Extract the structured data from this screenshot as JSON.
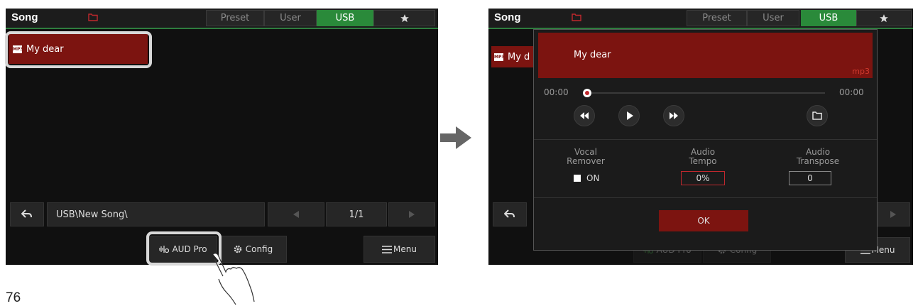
{
  "screen_left": {
    "header": {
      "title": "Song",
      "folder_icon": "folder-icon",
      "tabs": [
        {
          "label": "Preset"
        },
        {
          "label": "User"
        },
        {
          "label": "USB"
        },
        {
          "icon": "star-icon"
        }
      ]
    },
    "song_list": [
      {
        "label": "My dear",
        "icon": "mp3-icon"
      }
    ],
    "path": "USB\\New Song\\",
    "page": "1/1",
    "buttons": {
      "aud_pro": "AUD Pro",
      "config": "Config",
      "menu": "Menu"
    }
  },
  "screen_right": {
    "header": {
      "title": "Song",
      "tabs": [
        {
          "label": "Preset"
        },
        {
          "label": "User"
        },
        {
          "label": "USB"
        },
        {
          "icon": "star-icon"
        }
      ]
    },
    "song_list_partial": "My d",
    "dialog": {
      "song_title": "My dear",
      "format": "mp3",
      "time_start": "00:00",
      "time_end": "00:00",
      "vocal_remover": {
        "label_line1": "Vocal",
        "label_line2": "Remover",
        "value": "ON"
      },
      "audio_tempo": {
        "label_line1": "Audio",
        "label_line2": "Tempo",
        "value": "0%"
      },
      "audio_transpose": {
        "label_line1": "Audio",
        "label_line2": "Transpose",
        "value": "0"
      },
      "ok_label": "OK"
    },
    "buttons": {
      "aud_pro": "AUD Pro",
      "config": "Config",
      "menu": "Menu"
    }
  },
  "page_number": "76",
  "colors": {
    "accent_red": "#7c1410",
    "tab_green": "#2a8a3a",
    "highlight": "#d8d8d8"
  }
}
